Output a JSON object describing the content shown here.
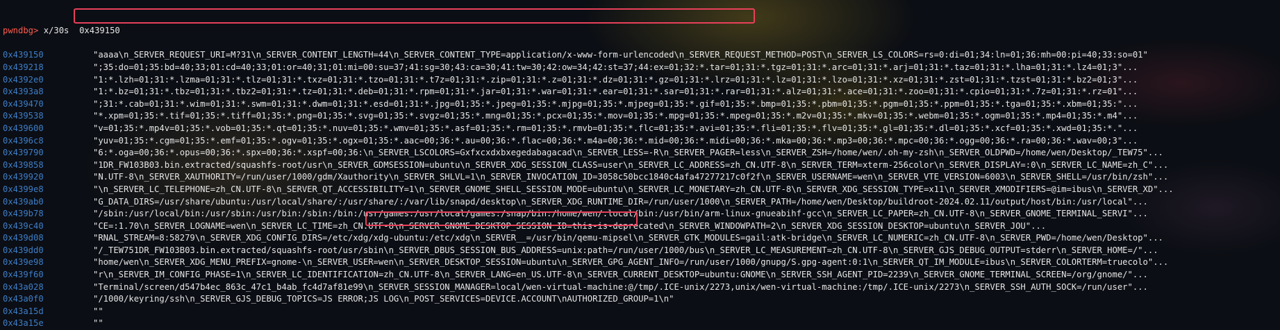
{
  "terminal": {
    "prompt": "pwndbg>",
    "command": " x/30s  0x439150",
    "rows": [
      {
        "addr": "0x439150",
        "text": "\"aaaa\\n_SERVER_REQUEST_URI=M?31\\n_SERVER_CONTENT_LENGTH=44\\n_SERVER_CONTENT_TYPE=application/x-www-form-urlencoded\\n_SERVER_REQUEST_METHOD=POST\\n_SERVER_LS_COLORS=rs=0:di=01;34:ln=01;36:mh=00:pi=40;33:so=01\""
      },
      {
        "addr": "0x439218",
        "text": "\";35:do=01;35:bd=40;33;01:cd=40;33;01:or=40;31;01:mi=00:su=37;41:sg=30;43:ca=30;41:tw=30;42:ow=34;42:st=37;44:ex=01;32:*.tar=01;31:*.tgz=01;31:*.arc=01;31:*.arj=01;31:*.taz=01;31:*.lha=01;31:*.lz4=01;3\"..."
      },
      {
        "addr": "0x4392e0",
        "text": "\"1:*.lzh=01;31:*.lzma=01;31:*.tlz=01;31:*.txz=01;31:*.tzo=01;31:*.t7z=01;31:*.zip=01;31:*.z=01;31:*.dz=01;31:*.gz=01;31:*.lrz=01;31:*.lz=01;31:*.lzo=01;31:*.xz=01;31:*.zst=01;31:*.tzst=01;31:*.bz2=01;3\"..."
      },
      {
        "addr": "0x4393a8",
        "text": "\"1:*.bz=01;31:*.tbz=01;31:*.tbz2=01;31:*.tz=01;31:*.deb=01;31:*.rpm=01;31:*.jar=01;31:*.war=01;31:*.ear=01;31:*.sar=01;31:*.rar=01;31:*.alz=01;31:*.ace=01;31:*.zoo=01;31:*.cpio=01;31:*.7z=01;31:*.rz=01\"..."
      },
      {
        "addr": "0x439470",
        "text": "\";31:*.cab=01;31:*.wim=01;31:*.swm=01;31:*.dwm=01;31:*.esd=01;31:*.jpg=01;35:*.jpeg=01;35:*.mjpg=01;35:*.mjpeg=01;35:*.gif=01;35:*.bmp=01;35:*.pbm=01;35:*.pgm=01;35:*.ppm=01;35:*.tga=01;35:*.xbm=01;35:\"..."
      },
      {
        "addr": "0x439538",
        "text": "\"*.xpm=01;35:*.tif=01;35:*.tiff=01;35:*.png=01;35:*.svg=01;35:*.svgz=01;35:*.mng=01;35:*.pcx=01;35:*.mov=01;35:*.mpg=01;35:*.mpeg=01;35:*.m2v=01;35:*.mkv=01;35:*.webm=01;35:*.ogm=01;35:*.mp4=01;35:*.m4\"..."
      },
      {
        "addr": "0x439600",
        "text": "\"v=01;35:*.mp4v=01;35:*.vob=01;35:*.qt=01;35:*.nuv=01;35:*.wmv=01;35:*.asf=01;35:*.rm=01;35:*.rmvb=01;35:*.flc=01;35:*.avi=01;35:*.fli=01;35:*.flv=01;35:*.gl=01;35:*.dl=01;35:*.xcf=01;35:*.xwd=01;35:*.\"..."
      },
      {
        "addr": "0x4396c8",
        "text": "\"yuv=01;35:*.cgm=01;35:*.emf=01;35:*.ogv=01;35:*.ogx=01;35:*.aac=00;36:*.au=00;36:*.flac=00;36:*.m4a=00;36:*.mid=00;36:*.midi=00;36:*.mka=00;36:*.mp3=00;36:*.mpc=00;36:*.ogg=00;36:*.ra=00;36:*.wav=00;3\"..."
      },
      {
        "addr": "0x439790",
        "text": "\"6:*.oga=00;36:*.opus=00;36:*.spx=00;36:*.xspf=00;36:\\n_SERVER_LSCOLORS=Gxfxcxdxbxegedabagacad\\n_SERVER_LESS=-R\\n_SERVER_PAGER=less\\n_SERVER_ZSH=/home/wen/.oh-my-zsh\\n_SERVER_OLDPWD=/home/wen/Desktop/_TEW75\"..."
      },
      {
        "addr": "0x439858",
        "text": "\"1DR_FW103B03.bin.extracted/squashfs-root/usr\\n_SERVER_GDMSESSION=ubuntu\\n_SERVER_XDG_SESSION_CLASS=user\\n_SERVER_LC_ADDRESS=zh_CN.UTF-8\\n_SERVER_TERM=xterm-256color\\n_SERVER_DISPLAY=:0\\n_SERVER_LC_NAME=zh_C\"..."
      },
      {
        "addr": "0x439920",
        "text": "\"N.UTF-8\\n_SERVER_XAUTHORITY=/run/user/1000/gdm/Xauthority\\n_SERVER_SHLVL=1\\n_SERVER_INVOCATION_ID=3058c50bcc1840c4afa47277217c0f2f\\n_SERVER_USERNAME=wen\\n_SERVER_VTE_VERSION=6003\\n_SERVER_SHELL=/usr/bin/zsh\"..."
      },
      {
        "addr": "0x4399e8",
        "text": "\"\\n_SERVER_LC_TELEPHONE=zh_CN.UTF-8\\n_SERVER_QT_ACCESSIBILITY=1\\n_SERVER_GNOME_SHELL_SESSION_MODE=ubuntu\\n_SERVER_LC_MONETARY=zh_CN.UTF-8\\n_SERVER_XDG_SESSION_TYPE=x11\\n_SERVER_XMODIFIERS=@im=ibus\\n_SERVER_XD\"..."
      },
      {
        "addr": "0x439ab0",
        "text": "\"G_DATA_DIRS=/usr/share/ubuntu:/usr/local/share/:/usr/share/:/var/lib/snapd/desktop\\n_SERVER_XDG_RUNTIME_DIR=/run/user/1000\\n_SERVER_PATH=/home/wen/Desktop/buildroot-2024.02.11/output/host/bin:/usr/local\"..."
      },
      {
        "addr": "0x439b78",
        "text": "\"/sbin:/usr/local/bin:/usr/sbin:/usr/bin:/sbin:/bin:/usr/games:/usr/local/games:/snap/bin:/home/wen/.local/bin:/usr/bin/arm-linux-gnueabihf-gcc\\n_SERVER_LC_PAPER=zh_CN.UTF-8\\n_SERVER_GNOME_TERMINAL_SERVI\"..."
      },
      {
        "addr": "0x439c40",
        "text": "\"CE=:1.70\\n_SERVER_LOGNAME=wen\\n_SERVER_LC_TIME=zh_CN.UTF-8\\n_SERVER_GNOME_DESKTOP_SESSION_ID=this-is-deprecated\\n_SERVER_WINDOWPATH=2\\n_SERVER_XDG_SESSION_DESKTOP=ubuntu\\n_SERVER_JOU\"..."
      },
      {
        "addr": "0x439d08",
        "text": "\"RNAL_STREAM=8:58279\\n_SERVER_XDG_CONFIG_DIRS=/etc/xdg/xdg-ubuntu:/etc/xdg\\n_SERVER__=/usr/bin/qemu-mipsel\\n_SERVER_GTK_MODULES=gail:atk-bridge\\n_SERVER_LC_NUMERIC=zh_CN.UTF-8\\n_SERVER_PWD=/home/wen/Desktop\"..."
      },
      {
        "addr": "0x439dd0",
        "text": "\"/_TEW751DR_FW103B03.bin.extracted/squashfs-root/usr/sbin\\n_SERVER_DBUS_SESSION_BUS_ADDRESS=unix:path=/run/user/1000/bus\\n_SERVER_LC_MEASUREMENT=zh_CN.UTF-8\\n_SERVER_GJS_DEBUG_OUTPUT=stderr\\n_SERVER_HOME=/\"..."
      },
      {
        "addr": "0x439e98",
        "text": "\"home/wen\\n_SERVER_XDG_MENU_PREFIX=gnome-\\n_SERVER_USER=wen\\n_SERVER_DESKTOP_SESSION=ubuntu\\n_SERVER_GPG_AGENT_INFO=/run/user/1000/gnupg/S.gpg-agent:0:1\\n_SERVER_QT_IM_MODULE=ibus\\n_SERVER_COLORTERM=truecolo\"..."
      },
      {
        "addr": "0x439f60",
        "text": "\"r\\n_SERVER_IM_CONFIG_PHASE=1\\n_SERVER_LC_IDENTIFICATION=zh_CN.UTF-8\\n_SERVER_LANG=en_US.UTF-8\\n_SERVER_CURRENT_DESKTOP=ubuntu:GNOME\\n_SERVER_SSH_AGENT_PID=2239\\n_SERVER_GNOME_TERMINAL_SCREEN=/org/gnome/\"..."
      },
      {
        "addr": "0x43a028",
        "text": "\"Terminal/screen/d547b4ec_863c_47c1_b4ab_fc4d7af81e99\\n_SERVER_SESSION_MANAGER=local/wen-virtual-machine:@/tmp/.ICE-unix/2273,unix/wen-virtual-machine:/tmp/.ICE-unix/2273\\n_SERVER_SSH_AUTH_SOCK=/run/user\"..."
      },
      {
        "addr": "0x43a0f0",
        "text": "\"/1000/keyring/ssh\\n_SERVER_GJS_DEBUG_TOPICS=JS ERROR;JS LOG\\n_POST_SERVICES=DEVICE.ACCOUNT\\nAUTHORIZED_GROUP=1\\n\""
      },
      {
        "addr": "0x43a15d",
        "text": "\"\""
      },
      {
        "addr": "0x43a15e",
        "text": "\"\""
      }
    ]
  }
}
